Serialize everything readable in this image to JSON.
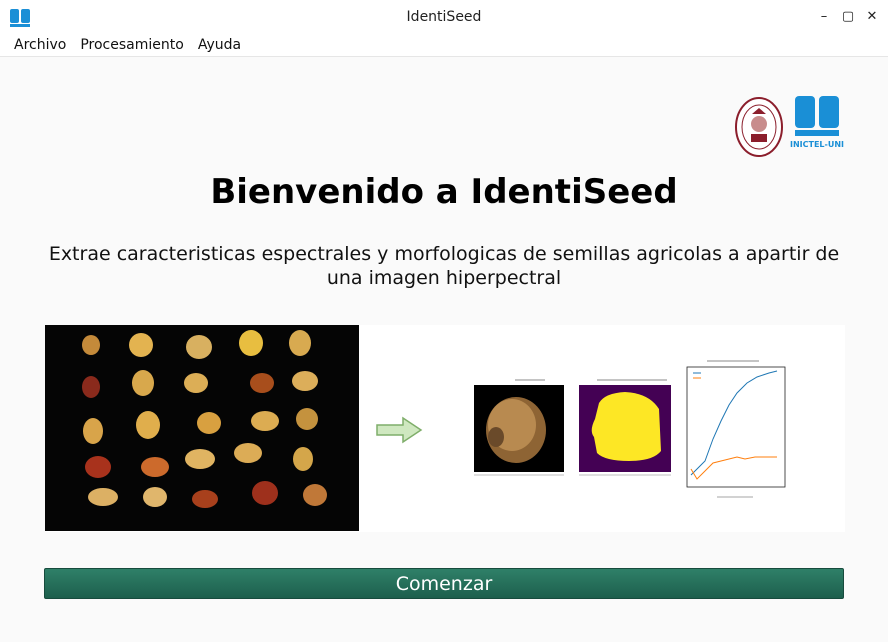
{
  "window": {
    "title": "IdentiSeed"
  },
  "menu": {
    "items": [
      "Archivo",
      "Procesamiento",
      "Ayuda"
    ]
  },
  "logos": {
    "uni_seal": "university-seal-icon",
    "inictel_text": "INICTEL-UNI"
  },
  "main": {
    "heading": "Bienvenido a IdentiSeed",
    "subtitle_line1": "Extrae caracteristicas espectrales y morfologicas de semillas agricolas a apartir de",
    "subtitle_line2": "una imagen hiperpectral",
    "start_button": "Comenzar"
  },
  "colors": {
    "button": "#2a7560",
    "logo_blue": "#1a8fd6",
    "seal_red": "#8b1e2c",
    "mask_purple": "#440154",
    "mask_yellow": "#fde725"
  }
}
